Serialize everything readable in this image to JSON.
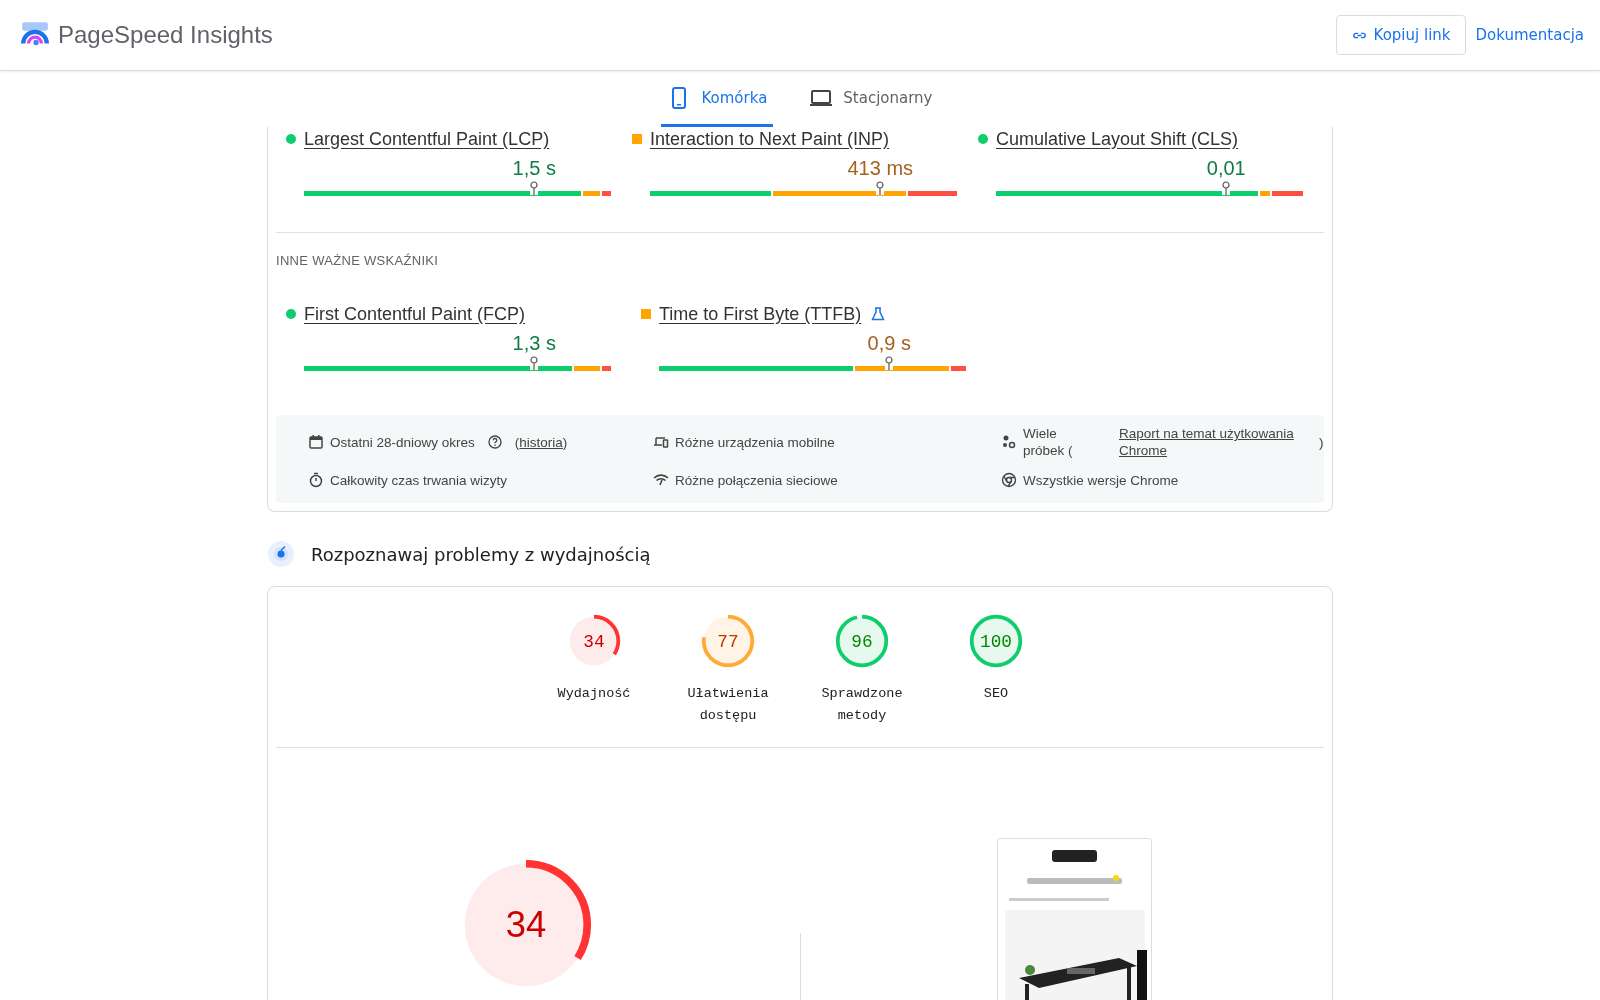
{
  "header": {
    "title": "PageSpeed Insights",
    "copy_button": "Kopiuj link",
    "docs_link": "Dokumentacja"
  },
  "tabs": [
    {
      "label": "Komórka",
      "kind": "phone",
      "selected": true
    },
    {
      "label": "Stacjonarny",
      "kind": "laptop",
      "selected": false
    }
  ],
  "core_metrics": [
    {
      "label": "Largest Contentful Paint (LCP)",
      "kind": "good",
      "value": "1,5 s",
      "marker": {
        "level": 0.75
      },
      "bar": {
        "good": {
          "level": 0.91
        },
        "good_and_improvement": {
          "level": 0.97
        }
      }
    },
    {
      "label": "Interaction to Next Paint (INP)",
      "kind": "improvement",
      "value": "413 ms",
      "marker": {
        "level": 0.75
      },
      "bar": {
        "good": {
          "level": 0.4
        },
        "good_and_improvement": {
          "level": 0.84
        }
      }
    },
    {
      "label": "Cumulative Layout Shift (CLS)",
      "kind": "good",
      "value": "0,01",
      "marker": {
        "level": 0.75
      },
      "bar": {
        "good": {
          "level": 0.86
        },
        "good_and_improvement": {
          "level": 0.9
        }
      }
    }
  ],
  "other_heading": "INNE WAŻNE WSKAŹNIKI",
  "other_metrics": [
    {
      "label": "First Contentful Paint (FCP)",
      "kind": "good",
      "value": "1,3 s",
      "experimental": false,
      "marker": {
        "level": 0.75
      },
      "bar": {
        "good": {
          "level": 0.88
        },
        "good_and_improvement": {
          "level": 0.97
        }
      }
    },
    {
      "label": "Time to First Byte (TTFB)",
      "kind": "improvement",
      "value": "0,9 s",
      "experimental": true,
      "marker": {
        "level": 0.75
      },
      "bar": {
        "good": {
          "level": 0.64
        },
        "good_and_improvement": {
          "level": 0.95
        }
      }
    }
  ],
  "info": [
    {
      "kind": "calendar",
      "text": "Ostatni 28-dniowy okres",
      "help": true,
      "link_before": "(",
      "link": "historia",
      "link_after": ")"
    },
    {
      "kind": "devices",
      "text": "Różne urządzenia mobilne"
    },
    {
      "kind": "samples",
      "text": "Wiele próbek (",
      "link": "Raport na temat użytkowania Chrome",
      "link_after": ")"
    },
    {
      "kind": "timer",
      "text": "Całkowity czas trwania wizyty"
    },
    {
      "kind": "network",
      "text": "Różne połączenia sieciowe"
    },
    {
      "kind": "chrome",
      "text": "Wszystkie wersje Chrome"
    }
  ],
  "section_title": "Rozpoznawaj problemy z wydajnością",
  "scores": [
    {
      "value": "34",
      "label": "Wydajność",
      "kind": "fail"
    },
    {
      "value": "77",
      "label": "Ułatwienia dostępu",
      "kind": "average"
    },
    {
      "value": "96",
      "label": "Sprawdzone metody",
      "kind": "pass"
    },
    {
      "value": "100",
      "label": "SEO",
      "kind": "pass"
    }
  ],
  "main_score": {
    "value": "34",
    "kind": "fail"
  }
}
